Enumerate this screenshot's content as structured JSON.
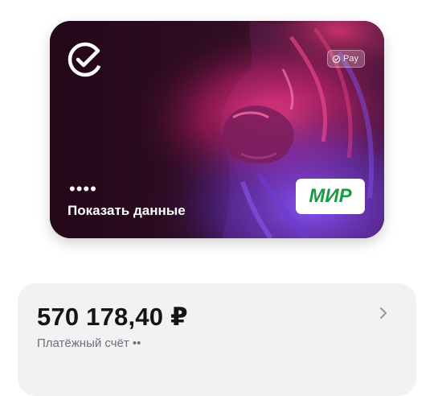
{
  "card": {
    "pay_badge_label": "Pay",
    "masked_number": "••••",
    "show_data_label": "Показать данные",
    "payment_system": "МИР",
    "colors": {
      "background": "#2a0b20",
      "accent_pink": "#e0307a",
      "accent_violet": "#6a3cd0",
      "mir_green": "#1a9a44"
    }
  },
  "account": {
    "balance": "570 178,40 ₽",
    "label": "Платёжный счёт ••"
  },
  "icons": {
    "bank_logo": "check-circle-icon",
    "pay_badge": "check-circle-icon",
    "open_account": "chevron-right-icon"
  }
}
